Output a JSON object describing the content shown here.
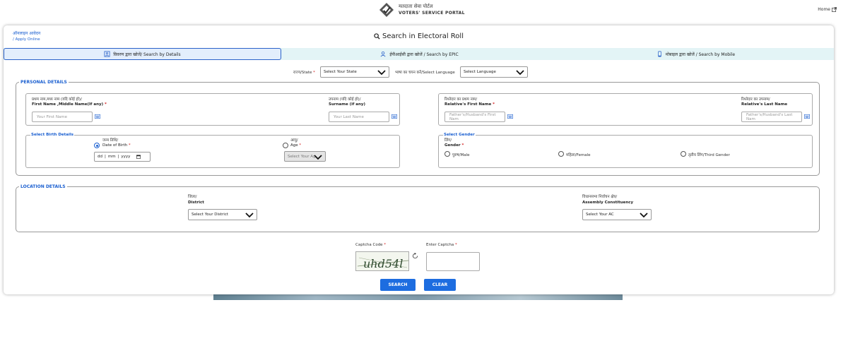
{
  "header": {
    "logo_hi": "मतदाता सेवा पोर्टल",
    "logo_en": "VOTERS' SERVICE PORTAL",
    "home_label": "Home"
  },
  "apply_online": {
    "hi": "ऑनलाइन आवेदन",
    "en": "/ Apply Online"
  },
  "title": "Search in Electoral Roll",
  "tabs": [
    {
      "label": "विवरण द्वारा खोजें/ Search by Details",
      "icon": "details-icon",
      "active": true
    },
    {
      "label": "ईपीआईसी द्वारा खोजें / Search by EPIC",
      "icon": "user-search-icon",
      "active": false
    },
    {
      "label": "मोबाइल द्वारा खोजें / Search by Mobile",
      "icon": "mobile-icon",
      "active": false
    }
  ],
  "state": {
    "label": "राज्य/State",
    "required_mark": "*",
    "value": "Select Your State"
  },
  "language": {
    "label": "भाषा का चयन करें/Select Language",
    "value": "Select Language"
  },
  "personal": {
    "legend": "PERSONAL DETAILS",
    "first_name": {
      "hi": "प्रथम नाम,मध्य नाम (यदि कोई हो)/",
      "en": "First Name ,Middle Name(If any)",
      "required_mark": "*",
      "placeholder": "Your First Name"
    },
    "surname": {
      "hi": "उपनाम (यदि कोई हो)/",
      "en": "Surname (if any)",
      "placeholder": "Your Last Name"
    },
    "relative_first": {
      "hi": "रिश्तेदार का प्रथम नाम/",
      "en": "Relative's First Name",
      "required_mark": "*",
      "placeholder": "Father's/Husband's First Nam"
    },
    "relative_last": {
      "hi": "रिश्तेदार का उपनाम/",
      "en": "Relative's Last Name",
      "placeholder": "Father's/Husband's Last Nam"
    },
    "birth": {
      "legend": "Select Birth Details",
      "dob_hi": "जन्म तिथि/",
      "dob_en": "Date of Birth",
      "dob_req": "*",
      "dob_dd": "dd",
      "dob_mm": "mm",
      "dob_yyyy": "yyyy",
      "age_hi": "आयु/",
      "age_en": "Age",
      "age_req": "*",
      "age_value": "Select Your Ag"
    },
    "gender": {
      "legend": "Select Gender",
      "hi": "लिंग/",
      "en": "Gender",
      "required_mark": "*",
      "male": "पुरुष/Male",
      "female": "महिला/Female",
      "third": "तृतीय लिंग/Third Gender"
    }
  },
  "location": {
    "legend": "LOCATION DETAILS",
    "district": {
      "hi": "जिला/",
      "en": "District",
      "value": "Select Your District"
    },
    "ac": {
      "hi": "विधानसभा निर्वाचन क्षेत्र/",
      "en": "Assembly Constituency",
      "value": "Select Your AC"
    }
  },
  "captcha": {
    "code_label": "Captcha Code",
    "enter_label": "Enter Captcha",
    "required_mark": "*",
    "code_text": "uhd54l"
  },
  "buttons": {
    "search": "SEARCH",
    "clear": "CLEAR"
  },
  "colors": {
    "accent": "#1a5fd0",
    "button": "#1d6de0",
    "tab_bg": "#e3f4f6"
  }
}
